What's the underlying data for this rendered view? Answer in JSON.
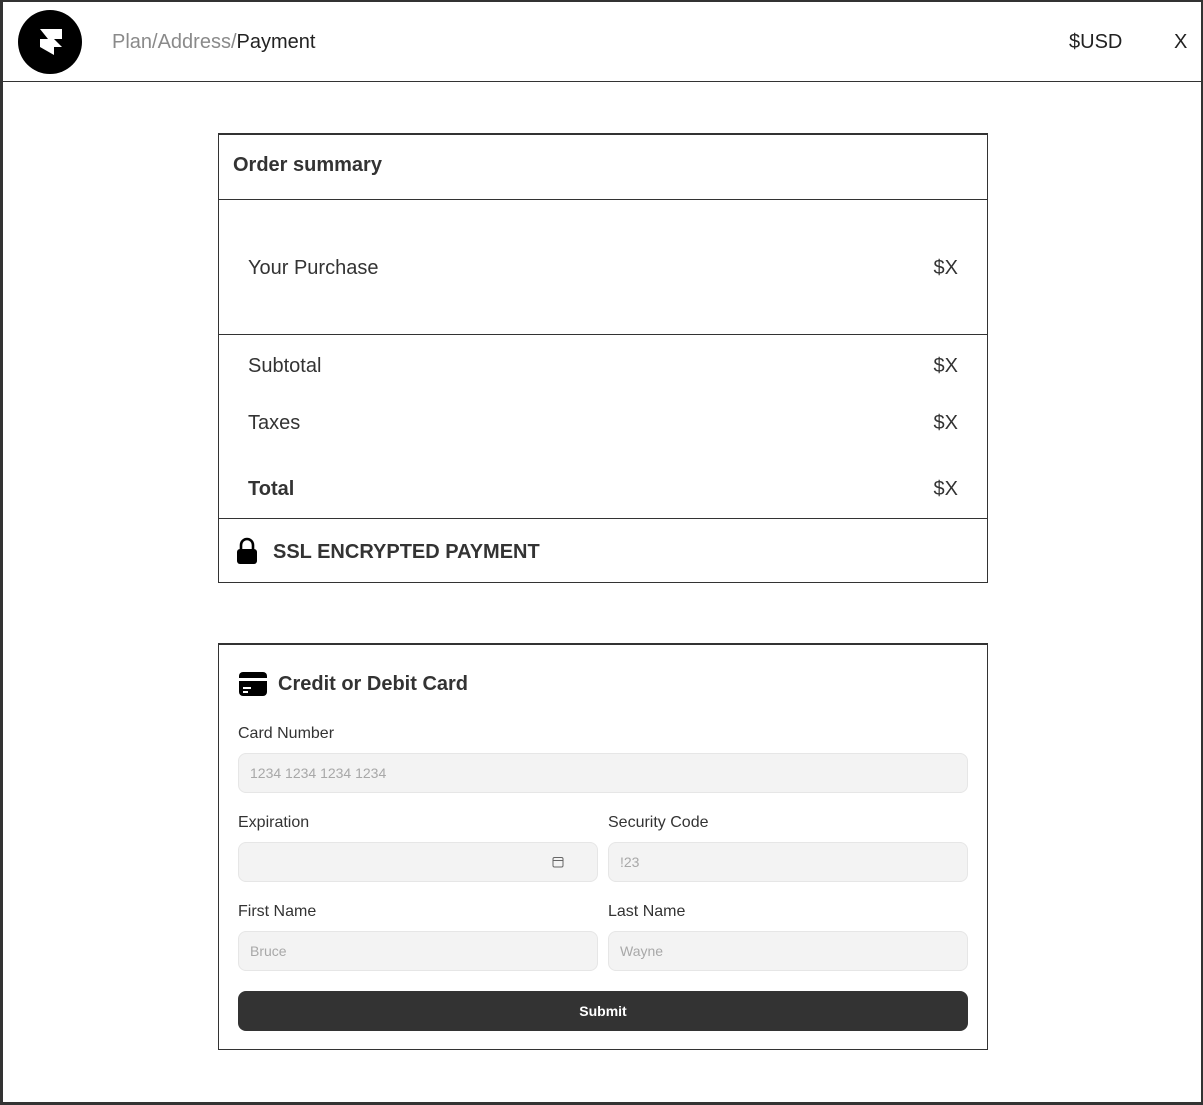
{
  "header": {
    "breadcrumb": {
      "step1": "Plan",
      "sep1": "/",
      "step2": "Address",
      "sep2": "/",
      "current": "Payment"
    },
    "currency": "$USD",
    "close_label": "X"
  },
  "order_summary": {
    "title": "Order summary",
    "purchase": {
      "label": "Your Purchase",
      "value": "$X"
    },
    "subtotal": {
      "label": "Subtotal",
      "value": "$X"
    },
    "taxes": {
      "label": "Taxes",
      "value": "$X"
    },
    "total": {
      "label": "Total",
      "value": "$X"
    },
    "ssl_label": "SSL ENCRYPTED PAYMENT"
  },
  "payment_form": {
    "title": "Credit or Debit Card",
    "card_number": {
      "label": "Card Number",
      "placeholder": "1234 1234 1234 1234"
    },
    "expiration": {
      "label": "Expiration",
      "placeholder": ""
    },
    "security_code": {
      "label": "Security Code",
      "placeholder": "!23"
    },
    "first_name": {
      "label": "First Name",
      "placeholder": "Bruce"
    },
    "last_name": {
      "label": "Last Name",
      "placeholder": "Wayne"
    },
    "submit_label": "Submit"
  },
  "icons": {
    "logo": "framer-logo",
    "lock": "lock-icon",
    "card": "credit-card-icon",
    "calendar": "calendar-icon"
  }
}
